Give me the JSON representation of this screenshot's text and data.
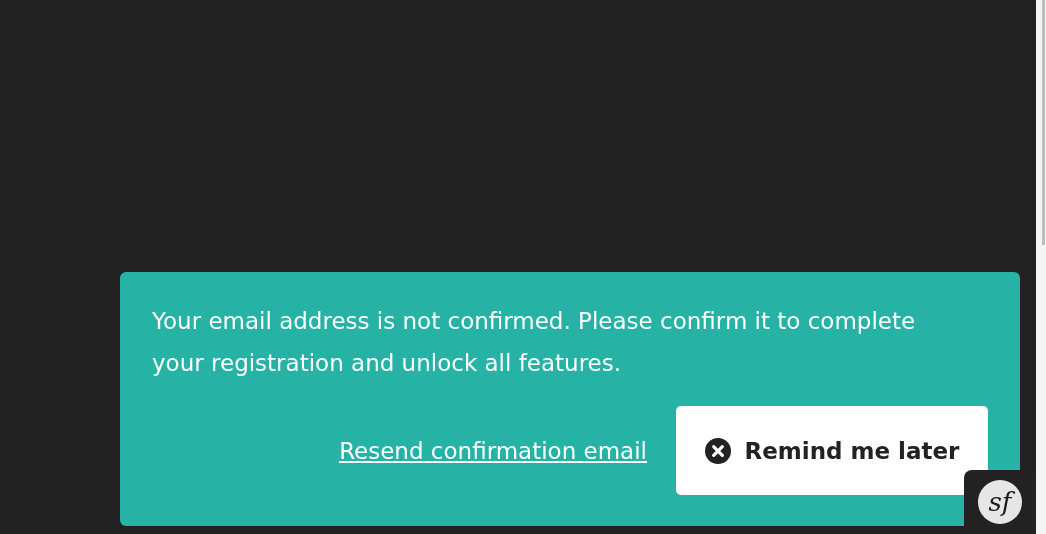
{
  "banner": {
    "message": "Your email address is not confirmed. Please confirm it to complete your registration and unlock all features.",
    "link": "Resend confirmation email",
    "button": "Remind me later"
  },
  "debug_toolbar": {
    "logo": "sf"
  }
}
